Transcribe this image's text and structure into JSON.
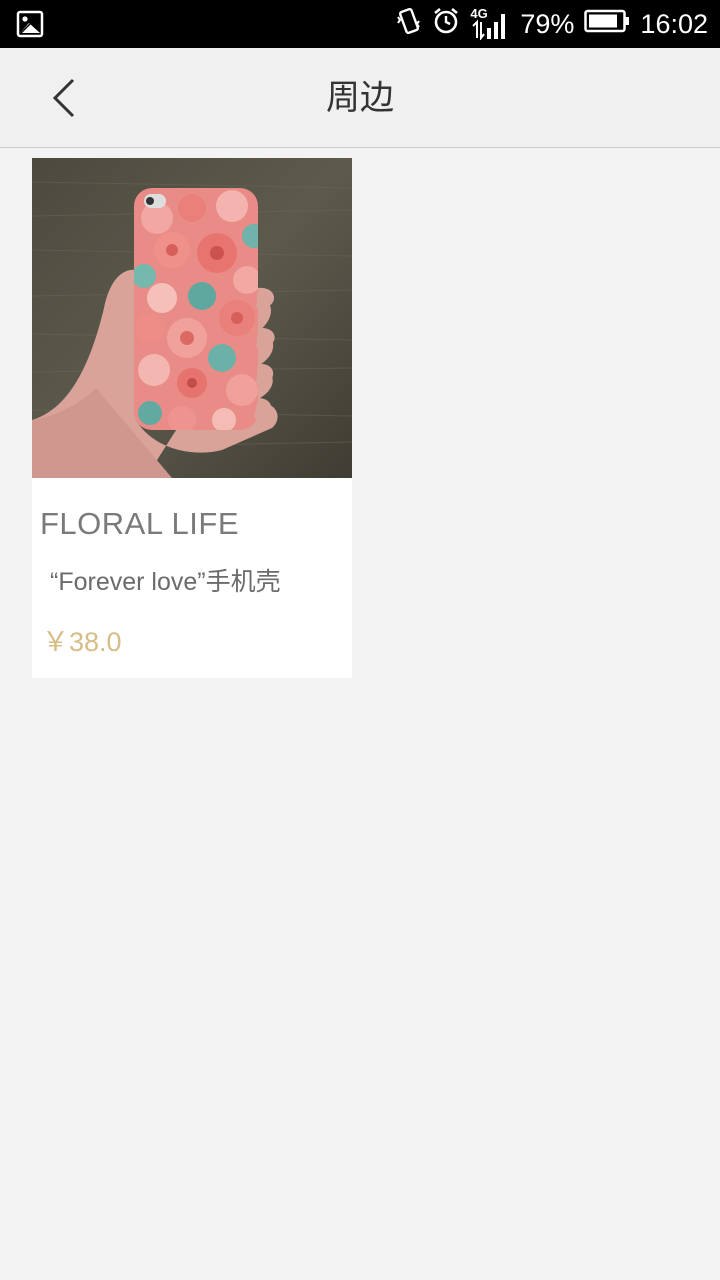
{
  "status_bar": {
    "battery": "79%",
    "time": "16:02",
    "network": "4G",
    "icons": [
      "gallery-icon",
      "vibrate-icon",
      "alarm-icon",
      "signal-icon",
      "battery-icon"
    ]
  },
  "header": {
    "title": "周边",
    "back_icon": "chevron-left-icon"
  },
  "products": [
    {
      "brand": "FLORAL LIFE",
      "name": "“Forever love”手机壳",
      "price": "￥38.0",
      "image": "floral-phone-case-photo"
    }
  ],
  "colors": {
    "background": "#f3f3f3",
    "header": "#f0f0f0",
    "price": "#d7bd86",
    "status_bar": "#000000"
  }
}
